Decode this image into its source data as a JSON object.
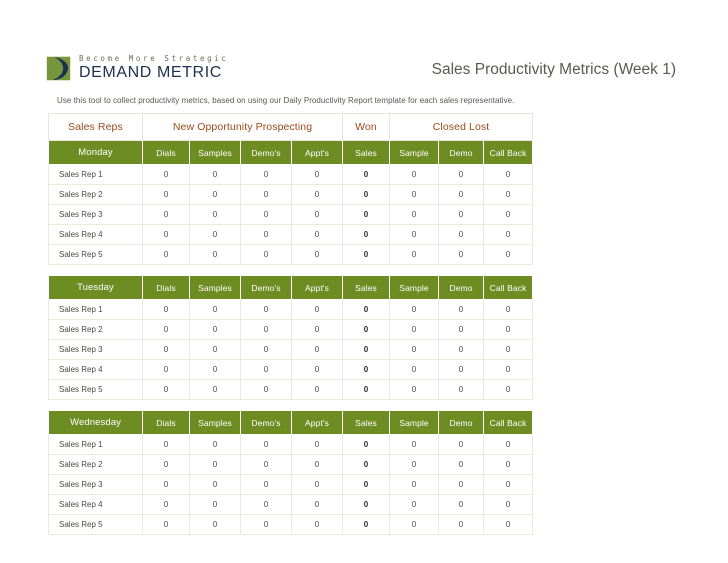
{
  "brand": {
    "tagline": "Become More Strategic",
    "name": "DEMAND METRIC",
    "mark_green": "#77953b",
    "mark_navy": "#1c3050"
  },
  "document": {
    "title": "Sales Productivity Metrics (Week 1)",
    "intro": "Use this tool to collect productivity metrics, based on using our Daily Productivity Report template for each sales representative."
  },
  "colors": {
    "day_header_bg": "#6d8c22",
    "group_header_text": "#9c4a1a",
    "row_border": "#eceadf",
    "title_text": "#5a5a52"
  },
  "table": {
    "group_headers": [
      {
        "label": "Sales Reps",
        "span": 1
      },
      {
        "label": "New Opportunity Prospecting",
        "span": 4
      },
      {
        "label": "Won",
        "span": 1
      },
      {
        "label": "Closed Lost",
        "span": 3
      }
    ],
    "metric_columns": [
      "Dials",
      "Samples",
      "Demo's",
      "Appt's",
      "Sales",
      "Sample",
      "Demo",
      "Call Back"
    ],
    "won_column_index": 4,
    "sections": [
      {
        "day": "Monday",
        "rows": [
          {
            "rep": "Sales Rep 1",
            "values": [
              "0",
              "0",
              "0",
              "0",
              "0",
              "0",
              "0",
              "0"
            ]
          },
          {
            "rep": "Sales Rep 2",
            "values": [
              "0",
              "0",
              "0",
              "0",
              "0",
              "0",
              "0",
              "0"
            ]
          },
          {
            "rep": "Sales Rep 3",
            "values": [
              "0",
              "0",
              "0",
              "0",
              "0",
              "0",
              "0",
              "0"
            ]
          },
          {
            "rep": "Sales Rep 4",
            "values": [
              "0",
              "0",
              "0",
              "0",
              "0",
              "0",
              "0",
              "0"
            ]
          },
          {
            "rep": "Sales Rep 5",
            "values": [
              "0",
              "0",
              "0",
              "0",
              "0",
              "0",
              "0",
              "0"
            ]
          }
        ]
      },
      {
        "day": "Tuesday",
        "rows": [
          {
            "rep": "Sales Rep 1",
            "values": [
              "0",
              "0",
              "0",
              "0",
              "0",
              "0",
              "0",
              "0"
            ]
          },
          {
            "rep": "Sales Rep 2",
            "values": [
              "0",
              "0",
              "0",
              "0",
              "0",
              "0",
              "0",
              "0"
            ]
          },
          {
            "rep": "Sales Rep 3",
            "values": [
              "0",
              "0",
              "0",
              "0",
              "0",
              "0",
              "0",
              "0"
            ]
          },
          {
            "rep": "Sales Rep 4",
            "values": [
              "0",
              "0",
              "0",
              "0",
              "0",
              "0",
              "0",
              "0"
            ]
          },
          {
            "rep": "Sales Rep 5",
            "values": [
              "0",
              "0",
              "0",
              "0",
              "0",
              "0",
              "0",
              "0"
            ]
          }
        ]
      },
      {
        "day": "Wednesday",
        "rows": [
          {
            "rep": "Sales Rep 1",
            "values": [
              "0",
              "0",
              "0",
              "0",
              "0",
              "0",
              "0",
              "0"
            ]
          },
          {
            "rep": "Sales Rep 2",
            "values": [
              "0",
              "0",
              "0",
              "0",
              "0",
              "0",
              "0",
              "0"
            ]
          },
          {
            "rep": "Sales Rep 3",
            "values": [
              "0",
              "0",
              "0",
              "0",
              "0",
              "0",
              "0",
              "0"
            ]
          },
          {
            "rep": "Sales Rep 4",
            "values": [
              "0",
              "0",
              "0",
              "0",
              "0",
              "0",
              "0",
              "0"
            ]
          },
          {
            "rep": "Sales Rep 5",
            "values": [
              "0",
              "0",
              "0",
              "0",
              "0",
              "0",
              "0",
              "0"
            ]
          }
        ]
      }
    ]
  }
}
